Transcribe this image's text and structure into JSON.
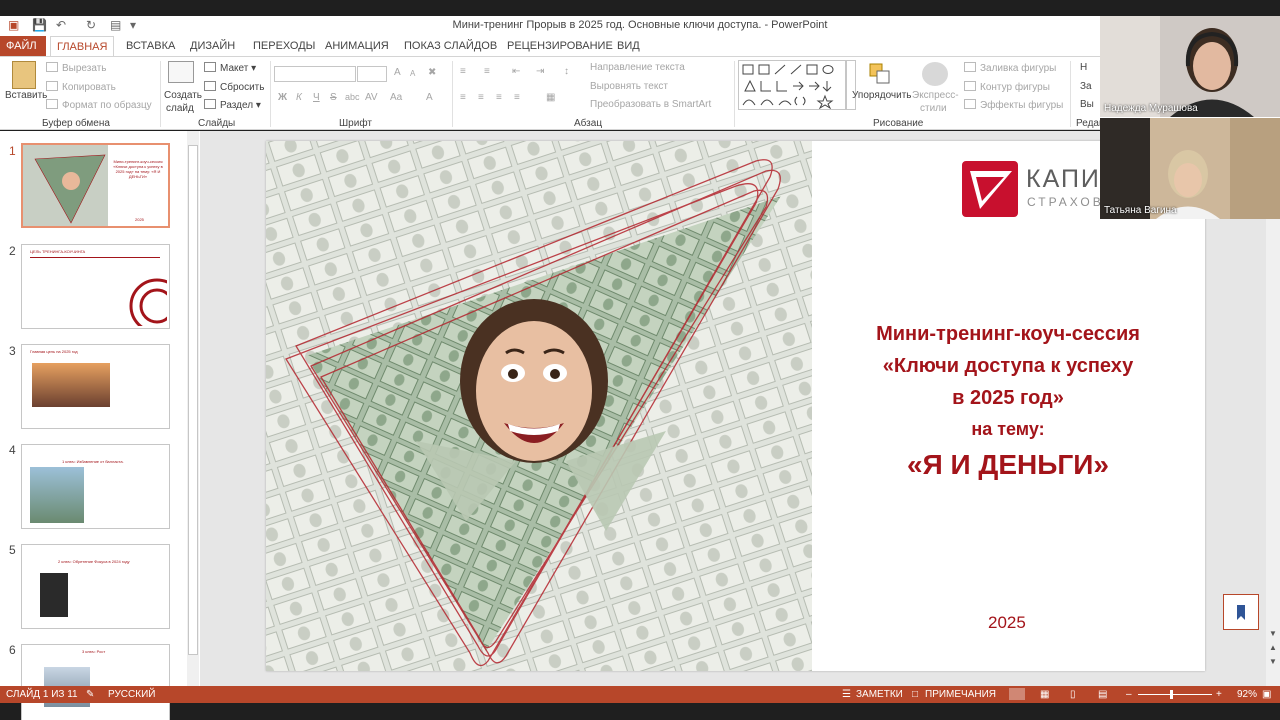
{
  "window": {
    "title": "Мини-тренинг Прорыв в 2025 год. Основные ключи доступа. - PowerPoint"
  },
  "tabs": [
    {
      "label": "ФАЙЛ"
    },
    {
      "label": "ГЛАВНАЯ"
    },
    {
      "label": "ВСТАВКА"
    },
    {
      "label": "ДИЗАЙН"
    },
    {
      "label": "ПЕРЕХОДЫ"
    },
    {
      "label": "АНИМАЦИЯ"
    },
    {
      "label": "ПОКАЗ СЛАЙДОВ"
    },
    {
      "label": "РЕЦЕНЗИРОВАНИЕ"
    },
    {
      "label": "ВИД"
    }
  ],
  "ribbon": {
    "clipboard": {
      "paste": "Вставить",
      "cut": "Вырезать",
      "copy": "Копировать",
      "format_painter": "Формат по образцу",
      "label": "Буфер обмена"
    },
    "slides": {
      "new_slide_1": "Создать",
      "new_slide_2": "слайд",
      "layout": "Макет",
      "reset": "Сбросить",
      "section": "Раздел",
      "label": "Слайды"
    },
    "font": {
      "bold": "Ж",
      "italic": "К",
      "underline": "Ч",
      "strike": "S",
      "spacing": "abc",
      "grow": "A",
      "shrink": "A",
      "case": "Aa",
      "clear": "A",
      "label": "Шрифт"
    },
    "paragraph": {
      "text_direction": "Направление текста",
      "align_text": "Выровнять текст",
      "smartart": "Преобразовать в SmartArt",
      "label": "Абзац"
    },
    "drawing": {
      "arrange": "Упорядочить",
      "quick_styles_1": "Экспресс-",
      "quick_styles_2": "стили",
      "shape_fill": "Заливка фигуры",
      "shape_outline": "Контур фигуры",
      "shape_effects": "Эффекты фигуры",
      "label": "Рисование"
    },
    "editing": {
      "label": "Редак",
      "find": "Н",
      "replace": "За",
      "select": "Вы"
    }
  },
  "thumbnails": [
    {
      "num": "1",
      "title": "Мини-тренинг-коуч-сессия «Ключи доступа к успеху в 2025 год» на тему: «Я И ДЕНЬГИ»",
      "footer": "2025"
    },
    {
      "num": "2",
      "title": "ЦЕЛЬ ТРЕНИНГА-КОУЧИНГА",
      "footer": ""
    },
    {
      "num": "3",
      "title": "Главная цель на 2025 год",
      "footer": ""
    },
    {
      "num": "4",
      "title": "1 ключ: Избавление от балласта.",
      "footer": ""
    },
    {
      "num": "5",
      "title": "2 ключ: Обретение Фокуса в 2024 году",
      "footer": ""
    },
    {
      "num": "6",
      "title": "3 ключ: Рост",
      "footer": ""
    }
  ],
  "slide": {
    "logo_top": "КАПИТ",
    "logo_bottom": "СТРАХОВА",
    "line1": "Мини-тренинг-коуч-сессия",
    "line2": "«Ключи доступа к успеху",
    "line3": "в 2025 год»",
    "line4": "на тему:",
    "line5": "«Я И ДЕНЬГИ»",
    "year": "2025"
  },
  "status": {
    "slide_count": "СЛАЙД 1 ИЗ 11",
    "language": "РУССКИЙ",
    "notes": "ЗАМЕТКИ",
    "comments": "ПРИМЕЧАНИЯ",
    "zoom": "92%"
  },
  "participants": [
    {
      "name": "Надежда Мурашова"
    },
    {
      "name": "Татьяна Вагина"
    }
  ],
  "colors": {
    "accent": "#b7472a",
    "slide_title": "#a3141a",
    "logo_red": "#c8102e"
  }
}
